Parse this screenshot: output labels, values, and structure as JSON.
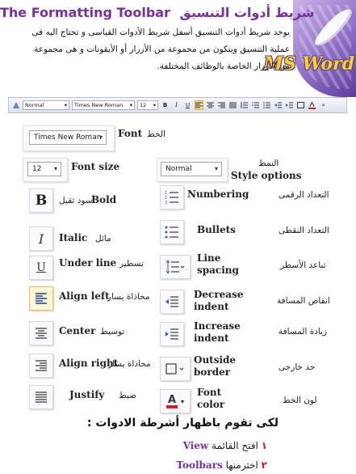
{
  "header": {
    "title_arabic": "شريط أدوات التنسيق",
    "title_english": "The Formatting Toolbar",
    "brand": "MS Word"
  },
  "intro": "يوجد شريط أدوات التنسيق أسفل شريط الأدوات القياسى و تحتاج اليه فى عملية التنسيق ويتكون من مجموعة من الأزرار أو الأيقونات و هى مجموعة من الأزرار الخاصة بالوظائف المختلفة.",
  "toolbar": {
    "style_value": "Normal",
    "font_value": "Times New Roman",
    "size_value": "12",
    "bold": "B",
    "italic": "I",
    "underline": "U",
    "more": "»"
  },
  "controls": {
    "font": {
      "value": "Times New Roman",
      "en": "Font",
      "ar": "الخط"
    },
    "font_size": {
      "value": "12",
      "en": "Font size"
    },
    "style": {
      "value": "Normal",
      "en": "Style options",
      "ar": "النمط"
    }
  },
  "buttons": {
    "bold": {
      "glyph": "B",
      "en": "Bold",
      "ar": "أسود ثقيل"
    },
    "italic": {
      "glyph": "I",
      "en": "Italic",
      "ar": "مائل"
    },
    "underline": {
      "glyph": "U",
      "en": "Under line",
      "ar": "تسطير"
    },
    "align_left": {
      "en": "Align left",
      "ar": "محاذاة يسار"
    },
    "center": {
      "en": "Center",
      "ar": "توسيط"
    },
    "align_right": {
      "en": "Align right",
      "ar": "محاذاة يسار"
    },
    "justify": {
      "en": "Justify",
      "ar": "ضبط"
    },
    "numbering": {
      "en": "Numbering",
      "ar": "التعداد الرقمى"
    },
    "bullets": {
      "en": "Bullets",
      "ar": "التعداد النقطى"
    },
    "line_spacing": {
      "en1": "Line",
      "en2": "spacing",
      "ar": "تباعد الأسطر"
    },
    "decrease_indent": {
      "en1": "Decrease",
      "en2": "indent",
      "ar": "انقاص المسافة"
    },
    "increase_indent": {
      "en1": "Increase",
      "en2": "indent",
      "ar": "زيادة المسافة"
    },
    "outside_border": {
      "en1": "Outside",
      "en2": "border",
      "ar": "حد خارجى"
    },
    "font_color": {
      "en1": "Font",
      "en2": "color",
      "ar": "لون الخط",
      "glyph": "A"
    }
  },
  "steps": {
    "heading": "لكى تقوم باظهار أشرطة الادوات :",
    "s1": {
      "num": "١",
      "ar": "افتح القائمة",
      "en": "View"
    },
    "s2": {
      "num": "٢",
      "ar": "اخترمنها",
      "en": "Toolbars"
    }
  },
  "colors": {
    "title": "#7a2f9e",
    "brand": "#ffd21a",
    "accent": "#c0202a"
  }
}
